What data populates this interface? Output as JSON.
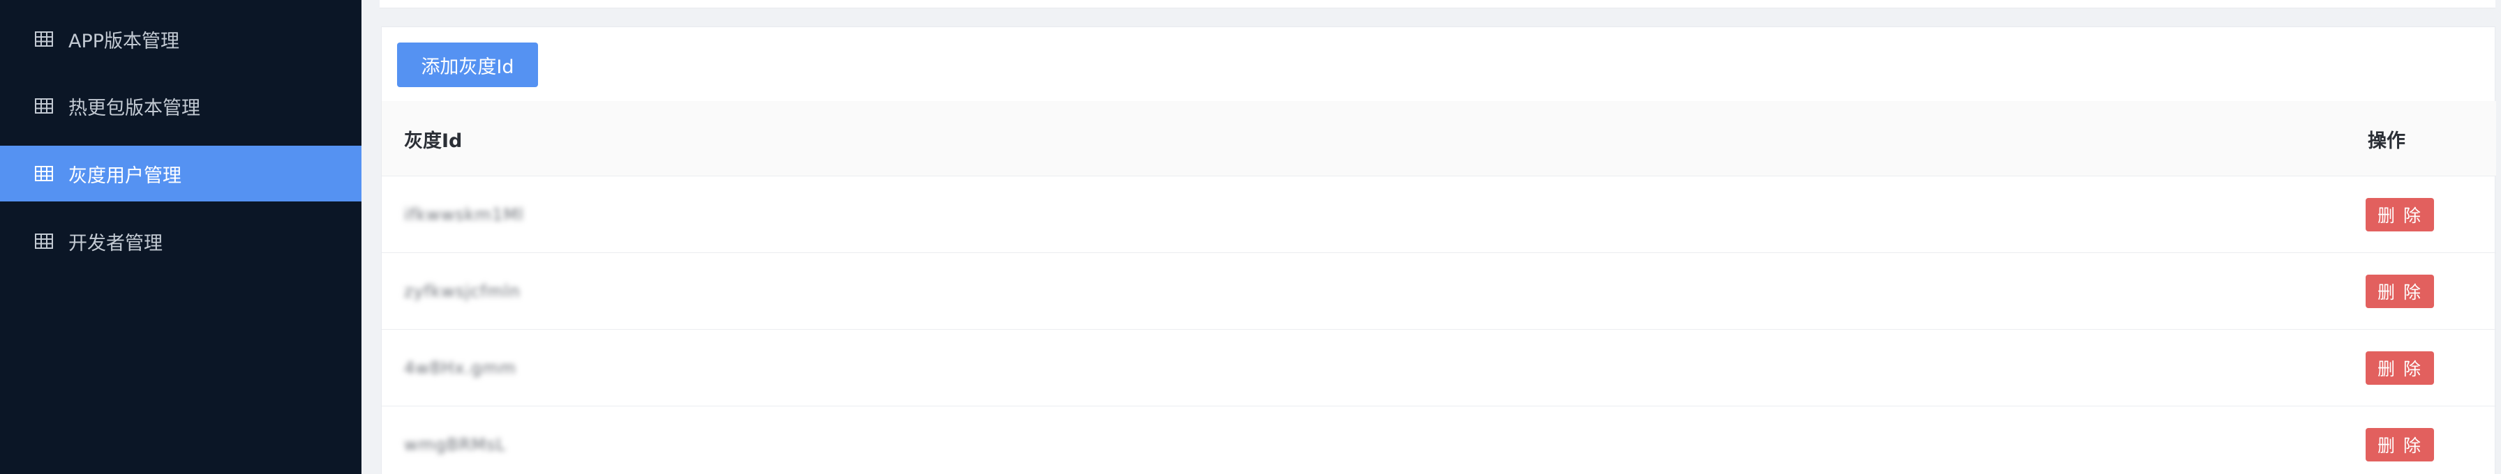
{
  "sidebar": {
    "items": [
      {
        "label": "APP版本管理",
        "icon": "grid-icon",
        "active": false
      },
      {
        "label": "热更包版本管理",
        "icon": "grid-icon",
        "active": false
      },
      {
        "label": "灰度用户管理",
        "icon": "grid-icon",
        "active": true
      },
      {
        "label": "开发者管理",
        "icon": "grid-icon",
        "active": false
      }
    ]
  },
  "main": {
    "add_button_label": "添加灰度Id",
    "table": {
      "columns": [
        "灰度Id",
        "操作"
      ],
      "rows": [
        {
          "id": "ifkwwskm1Ml",
          "action": "删 除"
        },
        {
          "id": "zyfkwsjcfmln",
          "action": "删 除"
        },
        {
          "id": "4w8Hx.gmm",
          "action": "删 除"
        },
        {
          "id": "wmgBRMsL",
          "action": "删 除"
        }
      ]
    }
  },
  "colors": {
    "sidebar_bg": "#0b1626",
    "accent": "#5592f2",
    "danger": "#e2605e"
  }
}
